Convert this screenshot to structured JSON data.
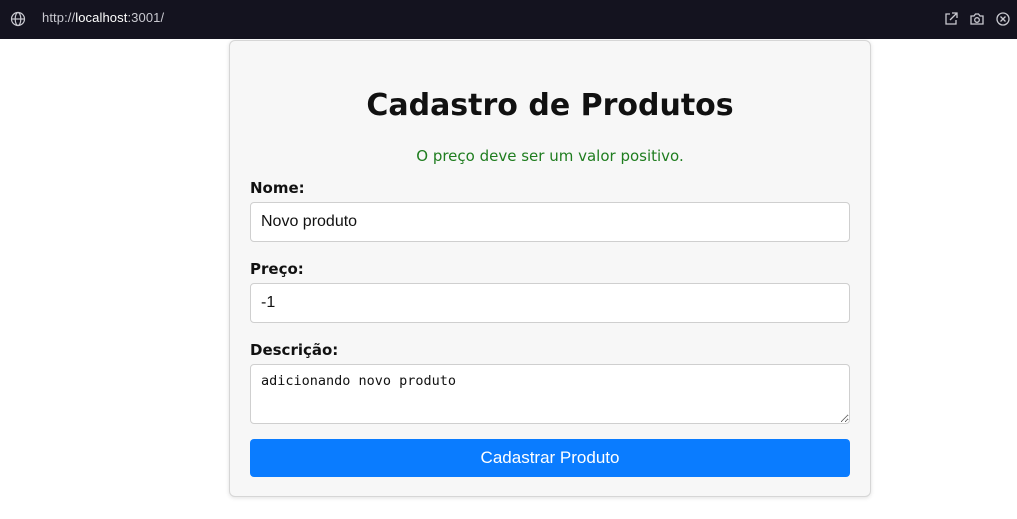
{
  "browser": {
    "url_prefix": "http://",
    "url_host": "localhost",
    "url_suffix": ":3001/"
  },
  "form": {
    "title": "Cadastro de Produtos",
    "message": "O preço deve ser um valor positivo.",
    "message_color": "#1f7d1f",
    "nome_label": "Nome:",
    "nome_value": "Novo produto",
    "preco_label": "Preço:",
    "preco_value": "-1",
    "descricao_label": "Descrição:",
    "descricao_value": "adicionando novo produto",
    "submit_label": "Cadastrar Produto",
    "accent_color": "#0a7cff"
  }
}
